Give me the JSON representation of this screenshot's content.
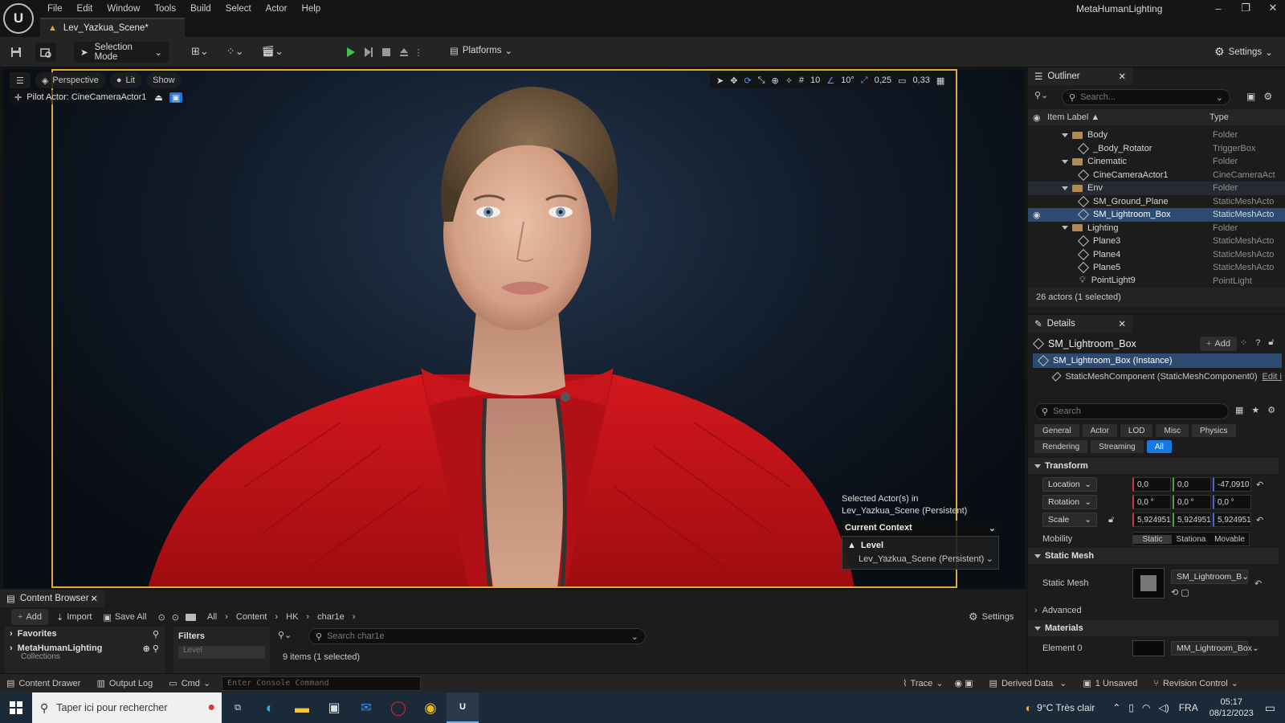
{
  "app": {
    "title": "MetaHumanLighting",
    "logo": "U",
    "document_tab": "Lev_Yazkua_Scene*"
  },
  "menu": [
    "File",
    "Edit",
    "Window",
    "Tools",
    "Build",
    "Select",
    "Actor",
    "Help"
  ],
  "toolbar": {
    "selection_mode": "Selection Mode",
    "platforms": "Platforms",
    "settings": "Settings"
  },
  "viewport": {
    "perspective": "Perspective",
    "lit": "Lit",
    "show": "Show",
    "pilot": "Pilot Actor: CineCameraActor1",
    "grid_snap": "10",
    "rotation_snap": "10°",
    "scale_snap": "0,25",
    "camera_speed": "0,33",
    "selection_info": "Selected Actor(s) in",
    "selection_scene": "Lev_Yazkua_Scene (Persistent)",
    "context_title": "Current Context",
    "context_level": "Level",
    "context_level_value": "Lev_Yazkua_Scene (Persistent)"
  },
  "outliner": {
    "title": "Outliner",
    "search_placeholder": "Search...",
    "col_label": "Item Label ▲",
    "col_type": "Type",
    "rows": [
      {
        "label": "Body",
        "type": "Folder"
      },
      {
        "label": "_Body_Rotator",
        "type": "TriggerBox"
      },
      {
        "label": "Cinematic",
        "type": "Folder"
      },
      {
        "label": "CineCameraActor1",
        "type": "CineCameraAct"
      },
      {
        "label": "Env",
        "type": "Folder"
      },
      {
        "label": "SM_Ground_Plane",
        "type": "StaticMeshActo"
      },
      {
        "label": "SM_Lightroom_Box",
        "type": "StaticMeshActo"
      },
      {
        "label": "Lighting",
        "type": "Folder"
      },
      {
        "label": "Plane3",
        "type": "StaticMeshActo"
      },
      {
        "label": "Plane4",
        "type": "StaticMeshActo"
      },
      {
        "label": "Plane5",
        "type": "StaticMeshActo"
      },
      {
        "label": "PointLight9",
        "type": "PointLight"
      }
    ],
    "footer": "26 actors (1 selected)"
  },
  "details": {
    "title": "Details",
    "object_name": "SM_Lightroom_Box",
    "add": "Add",
    "instance": "SM_Lightroom_Box (Instance)",
    "component": "StaticMeshComponent (StaticMeshComponent0)",
    "edit": "Edit i",
    "search_placeholder": "Search",
    "filters_row1": [
      "General",
      "Actor",
      "LOD",
      "Misc",
      "Physics"
    ],
    "filters_row2": [
      "Rendering",
      "Streaming",
      "All"
    ],
    "transform": "Transform",
    "location": {
      "label": "Location",
      "x": "0,0",
      "y": "0,0",
      "z": "-47,0910"
    },
    "rotation": {
      "label": "Rotation",
      "x": "0,0 °",
      "y": "0,0 °",
      "z": "0,0 °"
    },
    "scale": {
      "label": "Scale",
      "x": "5,924951",
      "y": "5,924951",
      "z": "5,924951"
    },
    "mobility": {
      "label": "Mobility",
      "options": [
        "Static",
        "Stationa",
        "Movable"
      ]
    },
    "static_mesh_cat": "Static Mesh",
    "static_mesh_label": "Static Mesh",
    "static_mesh_value": "SM_Lightroom_B",
    "advanced": "Advanced",
    "materials": "Materials",
    "element0": "Element 0",
    "element0_value": "MM_Lightroom_Box"
  },
  "content_browser": {
    "title": "Content Browser",
    "add": "Add",
    "import": "Import",
    "save_all": "Save All",
    "breadcrumb": [
      "All",
      "Content",
      "HK",
      "char1e"
    ],
    "settings": "Settings",
    "favorites": "Favorites",
    "project": "MetaHumanLighting",
    "collections": "Collections",
    "filters": "Filters",
    "search_placeholder": "Search char1e",
    "level_chip": "Level",
    "items": "9 items (1 selected)"
  },
  "statusbar": {
    "content_drawer": "Content Drawer",
    "output_log": "Output Log",
    "cmd": "Cmd",
    "console_placeholder": "Enter Console Command",
    "trace": "Trace",
    "derived_data": "Derived Data",
    "unsaved": "1 Unsaved",
    "revision": "Revision Control"
  },
  "taskbar": {
    "search": "Taper ici pour rechercher",
    "weather": "9°C  Très clair",
    "lang": "FRA",
    "time": "05:17",
    "date": "08/12/2023"
  },
  "colors": {
    "accent": "#1877e0",
    "selection": "#2d4a70",
    "frame": "#e0a93a",
    "jacket": "#c8141a"
  }
}
